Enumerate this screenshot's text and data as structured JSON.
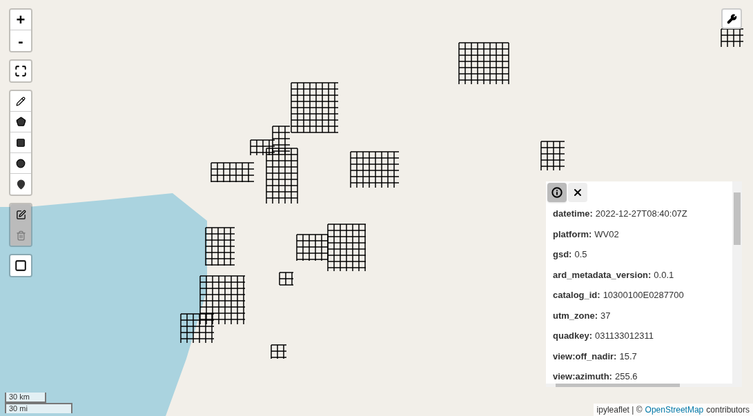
{
  "zoom": {
    "in": "+",
    "out": "-"
  },
  "popup": {
    "tabs": [
      {
        "kind": "info",
        "selected": true
      },
      {
        "kind": "close",
        "selected": false
      }
    ],
    "properties": [
      {
        "key": "datetime:",
        "value": "2022-12-27T08:40:07Z"
      },
      {
        "key": "platform:",
        "value": "WV02"
      },
      {
        "key": "gsd:",
        "value": "0.5"
      },
      {
        "key": "ard_metadata_version:",
        "value": "0.0.1"
      },
      {
        "key": "catalog_id:",
        "value": "10300100E0287700"
      },
      {
        "key": "utm_zone:",
        "value": "37"
      },
      {
        "key": "quadkey:",
        "value": "031133012311"
      },
      {
        "key": "view:off_nadir:",
        "value": "15.7"
      },
      {
        "key": "view:azimuth:",
        "value": "255.6"
      }
    ]
  },
  "scale": [
    "30 km",
    "30 mi"
  ],
  "attribution": {
    "prefix": "ipyleaflet | ©",
    "link": "OpenStreetMap",
    "suffix": "contributors"
  }
}
